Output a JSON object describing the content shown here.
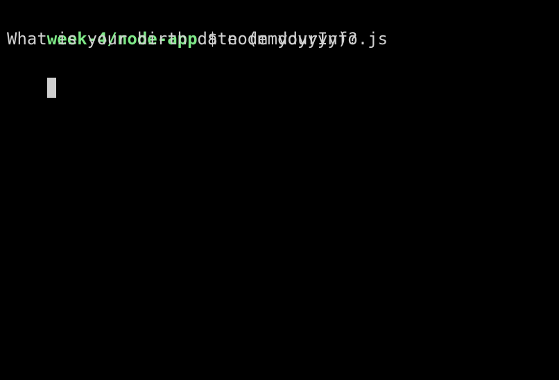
{
  "terminal": {
    "prompt_path": "week-4/node-app",
    "prompt_symbol": "$",
    "command": "node yourInfo.js",
    "output_line": "What is your birth date (mmddyyyy)?"
  },
  "colors": {
    "background": "#000000",
    "prompt_path": "#7ee787",
    "text": "#d0d0d0",
    "cursor": "#cfcfcf"
  }
}
